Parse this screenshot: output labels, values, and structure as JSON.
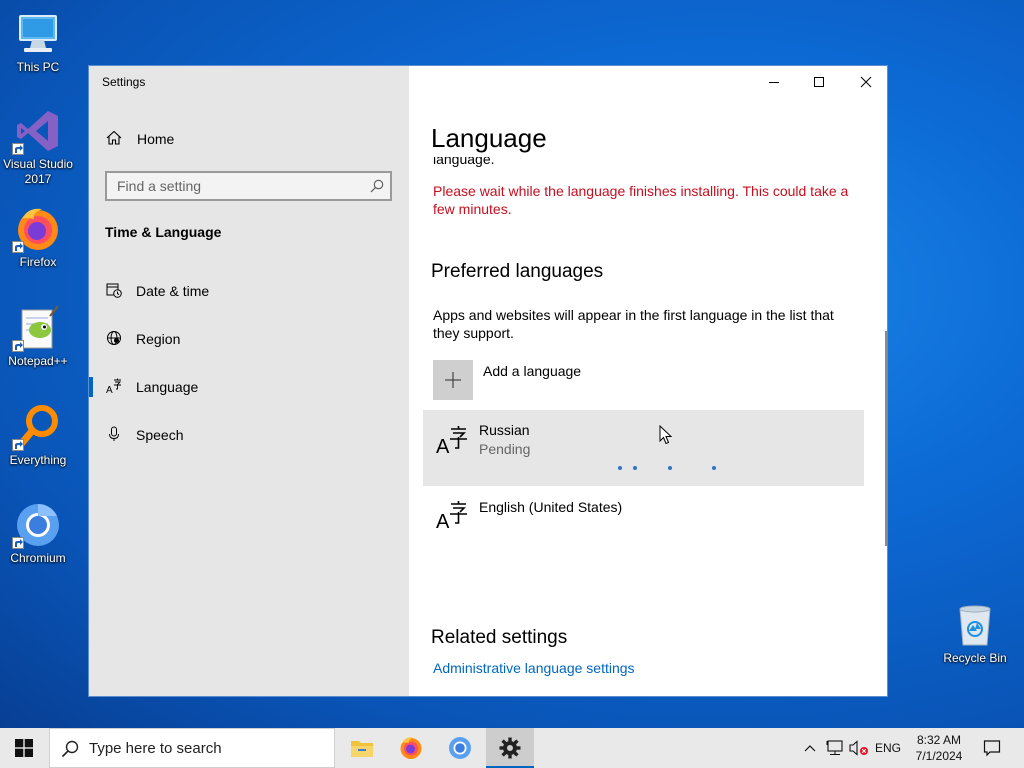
{
  "desktop": {
    "this_pc": "This PC",
    "visual_studio_line1": "Visual Studio",
    "visual_studio_line2": "2017",
    "firefox": "Firefox",
    "notepadpp": "Notepad++",
    "everything": "Everything",
    "chromium": "Chromium",
    "recycle_bin": "Recycle Bin"
  },
  "window": {
    "title": "Settings",
    "controls": [
      "minimize",
      "maximize",
      "close"
    ]
  },
  "sidebar": {
    "home": "Home",
    "search_placeholder": "Find a setting",
    "section_title": "Time & Language",
    "items": [
      {
        "label": "Date & time",
        "icon": "calendar-clock-icon"
      },
      {
        "label": "Region",
        "icon": "globe-icon"
      },
      {
        "label": "Language",
        "icon": "language-icon",
        "selected": true
      },
      {
        "label": "Speech",
        "icon": "microphone-icon"
      }
    ]
  },
  "content": {
    "heading": "Language",
    "clipped_text": "language.",
    "install_warning": "Please wait while the language finishes installing. This could take a few minutes.",
    "preferred_title": "Preferred languages",
    "preferred_desc": "Apps and websites will appear in the first language in the list that they support.",
    "add_language": "Add a language",
    "languages": [
      {
        "name": "Russian",
        "status": "Pending"
      },
      {
        "name": "English (United States)",
        "status": ""
      }
    ],
    "related_title": "Related settings",
    "related_link": "Administrative language settings"
  },
  "taskbar": {
    "search_placeholder": "Type here to search",
    "apps": [
      "file-explorer",
      "firefox",
      "chromium",
      "settings"
    ],
    "input_lang": "ENG",
    "time": "8:32 AM",
    "date": "7/1/2024"
  },
  "colors": {
    "accent": "#0067c0",
    "warning_text": "#c50f1f",
    "link": "#0067c0",
    "sidebar_bg": "#e6e6e6",
    "selected_row_bg": "#e6e6e6"
  }
}
